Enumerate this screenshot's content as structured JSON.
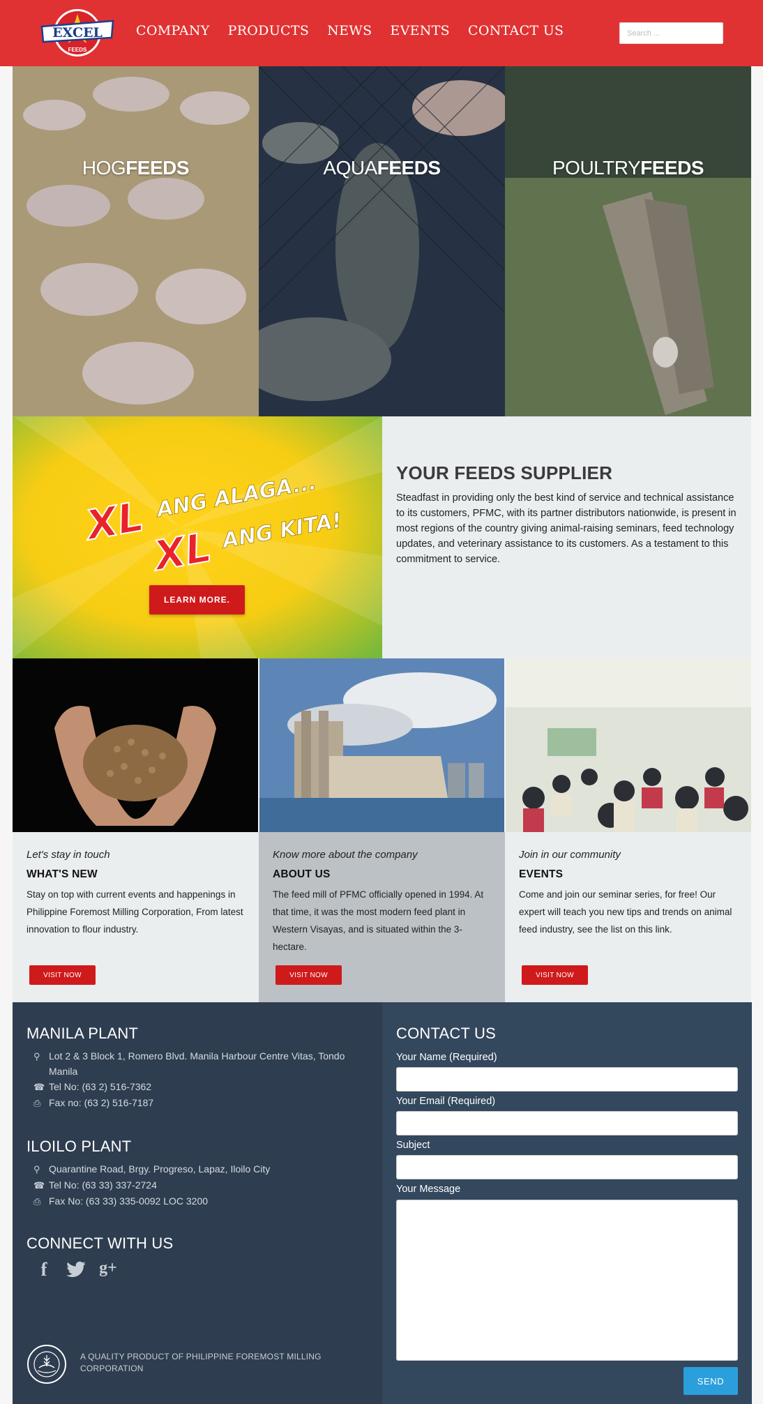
{
  "header": {
    "logo_text": "EXCEL",
    "logo_sub": "FEEDS",
    "nav": [
      "COMPANY",
      "PRODUCTS",
      "NEWS",
      "EVENTS",
      "CONTACT US"
    ],
    "search_placeholder": "Search ..."
  },
  "hero_panels": [
    {
      "light": "HOG",
      "bold": "FEEDS"
    },
    {
      "light": "AQUA",
      "bold": "FEEDS"
    },
    {
      "light": "POULTRY",
      "bold": "FEEDS"
    }
  ],
  "banner": {
    "line1_xl": "XL",
    "line1_text": "ANG ALAGA...",
    "line2_xl": "XL",
    "line2_text": "ANG KITA!",
    "button": "LEARN MORE."
  },
  "supplier": {
    "title": "YOUR FEEDS SUPPLIER",
    "body": "Steadfast in providing only the best kind of service and technical assistance to its customers, PFMC, with its partner distributors nationwide, is present in most regions of the country giving animal-raising seminars, feed technology updates, and veterinary assistance to its customers. As a testament to this commitment to service."
  },
  "cards": [
    {
      "sub": "Let's stay in touch",
      "title": "WHAT'S NEW",
      "body": "Stay on top with current events and happenings in Philippine Foremost Milling Corporation, From latest innovation to flour industry.",
      "button": "VISIT NOW"
    },
    {
      "sub": "Know more about the company",
      "title": "ABOUT US",
      "body": "The feed mill of PFMC officially opened in 1994. At that time, it was the most modern feed plant in Western Visayas, and is situated within the 3-hectare.",
      "button": "VISIT NOW"
    },
    {
      "sub": "Join in our community",
      "title": "EVENTS",
      "body": "Come and join our seminar series, for free! Our expert will teach you new tips and trends on animal feed industry, see the list on this link.",
      "button": "VISIT NOW"
    }
  ],
  "footer": {
    "manila": {
      "title": "MANILA PLANT",
      "address": "Lot 2 & 3 Block 1, Romero Blvd. Manila Harbour Centre Vitas, Tondo Manila",
      "tel": "Tel No: (63 2) 516-7362",
      "fax": "Fax no: (63 2) 516-7187"
    },
    "iloilo": {
      "title": "ILOILO PLANT",
      "address": "Quarantine Road, Brgy. Progreso, Lapaz, Iloilo City",
      "tel": "Tel No: (63 33) 337-2724",
      "fax": "Fax No: (63 33) 335-0092 LOC 3200"
    },
    "connect_title": "CONNECT WITH US",
    "social": [
      "f",
      "twitter",
      "g+"
    ],
    "quality": "A QUALITY PRODUCT OF PHILIPPINE FOREMOST MILLING CORPORATION",
    "seal_text": "PHILIPPINE FOREMOST MILLING CORPORATION"
  },
  "contact": {
    "title": "CONTACT US",
    "name_label": "Your Name (Required)",
    "email_label": "Your Email (Required)",
    "subject_label": "Subject",
    "message_label": "Your Message",
    "send": "SEND"
  },
  "colors": {
    "header_red": "#e03232",
    "button_red": "#cf1a1c",
    "footer_left": "#2e3d4f",
    "footer_right": "#33475d",
    "send_blue": "#2a9fdb"
  }
}
